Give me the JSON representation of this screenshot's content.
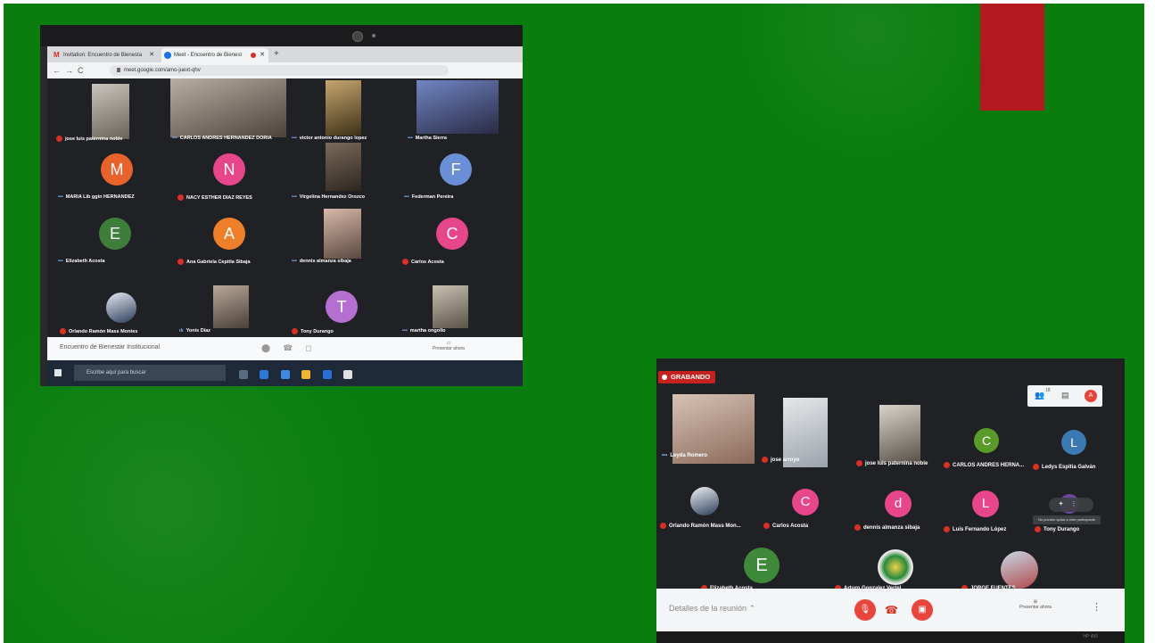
{
  "photo1": {
    "tabs": [
      {
        "label": "Invitation: Encuentro de Bienesta",
        "icon": "gmail-icon"
      },
      {
        "label": "Meet - Encuentro de Bienest",
        "icon": "meet-icon"
      }
    ],
    "url": "meet.google.com/amo-juext-qhv",
    "participants": [
      {
        "name": "jose luis paternina noble",
        "kind": "video"
      },
      {
        "name": "CARLOS ANDRES HERNANDEZ DORIA",
        "kind": "video"
      },
      {
        "name": "victor antonio durango lopez",
        "kind": "video"
      },
      {
        "name": "Martha Sierra",
        "kind": "video"
      },
      {
        "name": "MARIA Lib ggin HERNANDEZ",
        "kind": "avatar",
        "initial": "M",
        "color": "#e8622c"
      },
      {
        "name": "NACY ESTHER DIAZ REYES",
        "kind": "avatar",
        "initial": "N",
        "color": "#e8468a"
      },
      {
        "name": "Virgelina Hernandez Orozco",
        "kind": "video"
      },
      {
        "name": "Federman Pereira",
        "kind": "avatar",
        "initial": "F",
        "color": "#6b8fd6"
      },
      {
        "name": "Elizabeth Acosta",
        "kind": "avatar",
        "initial": "E",
        "color": "#3e7d3a"
      },
      {
        "name": "Ana Gabriela Cepitla Sibaja",
        "kind": "avatar",
        "initial": "A",
        "color": "#f07f2a"
      },
      {
        "name": "dennis almanza sibaja",
        "kind": "video"
      },
      {
        "name": "Carlos Acosta",
        "kind": "avatar",
        "initial": "C",
        "color": "#e8468a"
      },
      {
        "name": "Orlando Ramón Mass Montes",
        "kind": "video"
      },
      {
        "name": "Yonis Diaz",
        "kind": "video"
      },
      {
        "name": "Tony Durango",
        "kind": "avatar",
        "initial": "T",
        "color": "#b46fd1"
      },
      {
        "name": "martha ongollo",
        "kind": "video"
      }
    ],
    "meeting_name": "Encuentro de Bienestar Institucional",
    "present_label": "Presentar ahora",
    "taskbar_search": "Escribe aquí para buscar"
  },
  "photo2": {
    "recording_label": "GRABANDO",
    "participant_count": "18",
    "self_initial": "A",
    "tooltip": "No puedes quitar a este participante",
    "participants": [
      {
        "name": "Leyda Romero",
        "kind": "video"
      },
      {
        "name": "jose arroyo",
        "kind": "video"
      },
      {
        "name": "jose luis paternina noble",
        "kind": "video"
      },
      {
        "name": "CARLOS ANDRES HERNA...",
        "kind": "avatar",
        "initial": "C",
        "color": "#5a9a2a"
      },
      {
        "name": "Ledys Espitia Galván",
        "kind": "avatar",
        "initial": "L",
        "color": "#3a7ab0"
      },
      {
        "name": "Orlando Ramón Mass Mon...",
        "kind": "video"
      },
      {
        "name": "Carlos Acosta",
        "kind": "avatar",
        "initial": "C",
        "color": "#e8468a"
      },
      {
        "name": "dennis almanza sibaja",
        "kind": "avatar",
        "initial": "d",
        "color": "#e8468a"
      },
      {
        "name": "Luis Fernando López",
        "kind": "avatar",
        "initial": "L",
        "color": "#e8468a"
      },
      {
        "name": "Tony Durango",
        "kind": "avatar",
        "initial": "",
        "color": "#6a4aa0"
      },
      {
        "name": "Elizabeth Acosta",
        "kind": "avatar",
        "initial": "E",
        "color": "#3e8a3a"
      },
      {
        "name": "Arturo Gonzalez Vertel",
        "kind": "crest"
      },
      {
        "name": "JORGE FUENTES",
        "kind": "video"
      }
    ],
    "details_label": "Detalles de la reunión",
    "present_label": "Presentar ahora",
    "brand": "HP 450"
  }
}
